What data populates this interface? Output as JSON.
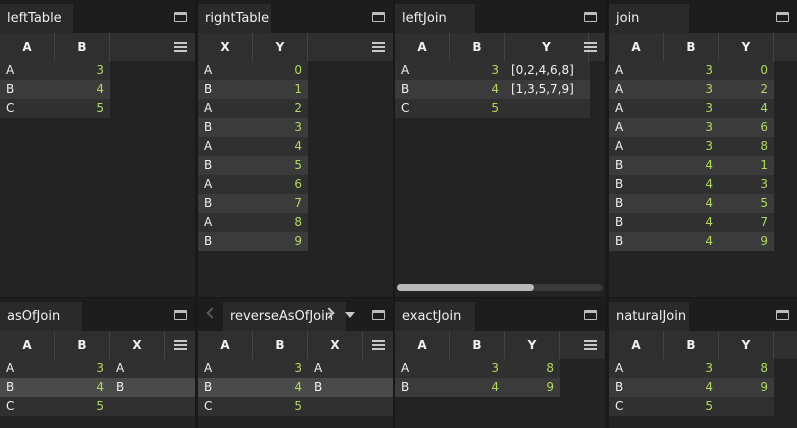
{
  "panels": [
    {
      "id": "leftTable",
      "title": "leftTable",
      "columns": [
        "A",
        "B"
      ],
      "types": [
        "txt",
        "num"
      ],
      "rows": [
        [
          "A",
          "3"
        ],
        [
          "B",
          "4"
        ],
        [
          "C",
          "5"
        ]
      ]
    },
    {
      "id": "rightTable",
      "title": "rightTable",
      "columns": [
        "X",
        "Y"
      ],
      "types": [
        "txt",
        "num"
      ],
      "rows": [
        [
          "A",
          "0"
        ],
        [
          "B",
          "1"
        ],
        [
          "A",
          "2"
        ],
        [
          "B",
          "3"
        ],
        [
          "A",
          "4"
        ],
        [
          "B",
          "5"
        ],
        [
          "A",
          "6"
        ],
        [
          "B",
          "7"
        ],
        [
          "A",
          "8"
        ],
        [
          "B",
          "9"
        ]
      ]
    },
    {
      "id": "leftJoin",
      "title": "leftJoin",
      "columns": [
        "A",
        "B",
        "Y"
      ],
      "types": [
        "txt",
        "num",
        "txt"
      ],
      "rows": [
        [
          "A",
          "3",
          "[0,2,4,6,8]"
        ],
        [
          "B",
          "4",
          "[1,3,5,7,9]"
        ],
        [
          "C",
          "5",
          ""
        ]
      ]
    },
    {
      "id": "join",
      "title": "join",
      "columns": [
        "A",
        "B",
        "Y"
      ],
      "types": [
        "txt",
        "num",
        "num"
      ],
      "rows": [
        [
          "A",
          "3",
          "0"
        ],
        [
          "A",
          "3",
          "2"
        ],
        [
          "A",
          "3",
          "4"
        ],
        [
          "A",
          "3",
          "6"
        ],
        [
          "A",
          "3",
          "8"
        ],
        [
          "B",
          "4",
          "1"
        ],
        [
          "B",
          "4",
          "3"
        ],
        [
          "B",
          "4",
          "5"
        ],
        [
          "B",
          "4",
          "7"
        ],
        [
          "B",
          "4",
          "9"
        ]
      ]
    },
    {
      "id": "asOfJoin",
      "title": "asOfJoin",
      "columns": [
        "A",
        "B",
        "X"
      ],
      "types": [
        "txt",
        "num",
        "txt"
      ],
      "rows": [
        [
          "A",
          "3",
          "A"
        ],
        [
          "B",
          "4",
          "B"
        ],
        [
          "C",
          "5",
          ""
        ]
      ]
    },
    {
      "id": "reverseAsOfJoin",
      "title": "reverseAsOfJoin",
      "columns": [
        "A",
        "B",
        "X"
      ],
      "types": [
        "txt",
        "num",
        "txt"
      ],
      "rows": [
        [
          "A",
          "3",
          "A"
        ],
        [
          "B",
          "4",
          "B"
        ],
        [
          "C",
          "5",
          ""
        ]
      ]
    },
    {
      "id": "exactJoin",
      "title": "exactJoin",
      "columns": [
        "A",
        "B",
        "Y"
      ],
      "types": [
        "txt",
        "num",
        "num"
      ],
      "rows": [
        [
          "A",
          "3",
          "8"
        ],
        [
          "B",
          "4",
          "9"
        ]
      ]
    },
    {
      "id": "naturalJoin",
      "title": "naturalJoin",
      "columns": [
        "A",
        "B",
        "Y"
      ],
      "types": [
        "txt",
        "num",
        "num"
      ],
      "rows": [
        [
          "A",
          "3",
          "8"
        ],
        [
          "B",
          "4",
          "9"
        ],
        [
          "C",
          "5",
          ""
        ]
      ]
    }
  ],
  "icons": {
    "maximize": "window-maximize-icon",
    "menu": "column-menu-icon",
    "tab_scroll_left": "chevron-left-icon",
    "tab_scroll_right": "chevron-right-icon",
    "tab_dropdown": "caret-down-icon"
  },
  "colors": {
    "background": "#1a191a",
    "panel": "#2a2a2b",
    "number_text": "#b1d861",
    "text": "#f0f0ee"
  },
  "highlighted_row": {
    "asOfJoin": 1,
    "reverseAsOfJoin": 1
  }
}
